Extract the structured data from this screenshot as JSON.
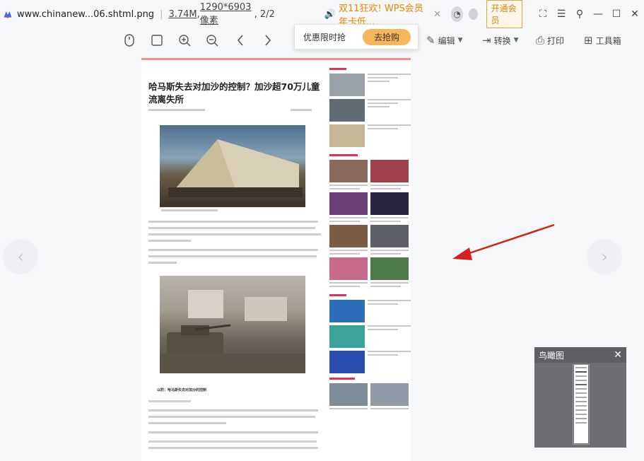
{
  "titlebar": {
    "filename": "www.chinanew...06.shtml.png",
    "size": "3.74M",
    "dimensions": "1290*6903像素",
    "page": "2/2",
    "promo": "双11狂欢! WPS会员年卡低...",
    "vip_button": "开通会员",
    "icons": [
      "app-logo-icon",
      "speaker-icon",
      "avatar-icon",
      "download-icon",
      "fullscreen-icon",
      "menu-icon",
      "pin-icon",
      "minimize-icon",
      "maximize-icon",
      "close-icon"
    ]
  },
  "toolbar": {
    "edit": "编辑",
    "convert": "转换",
    "print": "打印",
    "toolbox": "工具箱",
    "icons": [
      "mouse-icon",
      "fit-icon",
      "zoom-in-icon",
      "zoom-out-icon",
      "prev-icon",
      "next-icon"
    ]
  },
  "popup": {
    "text": "优惠限时抢",
    "button": "去抢购"
  },
  "document": {
    "headline": "哈马斯失去对加沙的控制？加沙超70万儿童流离失所",
    "sub_head": "以防：哈马斯失去对加沙的控制"
  },
  "minimap": {
    "title": "鸟瞰图"
  },
  "colors": {
    "promo": "#e88a00",
    "vip_border": "#e0a449",
    "buy_button": "#f7b55c",
    "arrow": "#d42020",
    "minimap_bg": "#6d6e72"
  }
}
